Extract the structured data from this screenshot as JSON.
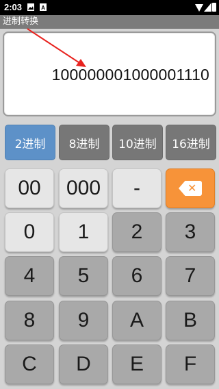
{
  "status_bar": {
    "time": "2:03",
    "icons": [
      "image-icon",
      "a-icon",
      "wifi-icon",
      "signal-icon",
      "battery-icon"
    ]
  },
  "app": {
    "title": "进制转换"
  },
  "display": {
    "value": "100000001000001110"
  },
  "base_tabs": [
    {
      "label": "2进制",
      "active": true
    },
    {
      "label": "8进制",
      "active": false
    },
    {
      "label": "10进制",
      "active": false
    },
    {
      "label": "16进制",
      "active": false
    }
  ],
  "keypad": {
    "row1": [
      "00",
      "000",
      "-"
    ],
    "backspace_icon": "backspace-icon",
    "row2": [
      "0",
      "1",
      "2",
      "3"
    ],
    "row3": [
      "4",
      "5",
      "6",
      "7"
    ],
    "row4": [
      "8",
      "9",
      "A",
      "B"
    ],
    "row5": [
      "C",
      "D",
      "E",
      "F"
    ]
  },
  "colors": {
    "active_tab": "#5d91c8",
    "inactive_tab": "#777777",
    "backspace": "#f79339",
    "annotation_arrow": "#e8231f"
  }
}
